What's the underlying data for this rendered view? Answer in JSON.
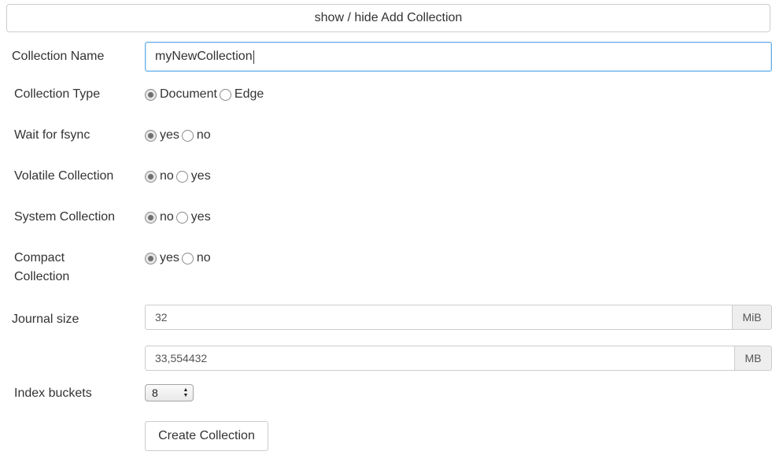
{
  "toggle_button": "show / hide Add Collection",
  "collection_name": {
    "label": "Collection Name",
    "value": "myNewCollection"
  },
  "collection_type": {
    "label": "Collection Type",
    "options": [
      "Document",
      "Edge"
    ],
    "selected": "Document"
  },
  "wait_for_fsync": {
    "label": "Wait for fsync",
    "options": [
      "yes",
      "no"
    ],
    "selected": "yes"
  },
  "volatile_collection": {
    "label": "Volatile Collection",
    "options": [
      "no",
      "yes"
    ],
    "selected": "no"
  },
  "system_collection": {
    "label": "System Collection",
    "options": [
      "no",
      "yes"
    ],
    "selected": "no"
  },
  "compact_collection": {
    "label_line1": "Compact",
    "label_line2": "Collection",
    "options": [
      "yes",
      "no"
    ],
    "selected": "yes"
  },
  "journal_size": {
    "label": "Journal size",
    "mib_value": "32",
    "mib_unit": "MiB",
    "mb_value": "33,554432",
    "mb_unit": "MB"
  },
  "index_buckets": {
    "label": "Index buckets",
    "selected": "8"
  },
  "create_button": "Create Collection"
}
